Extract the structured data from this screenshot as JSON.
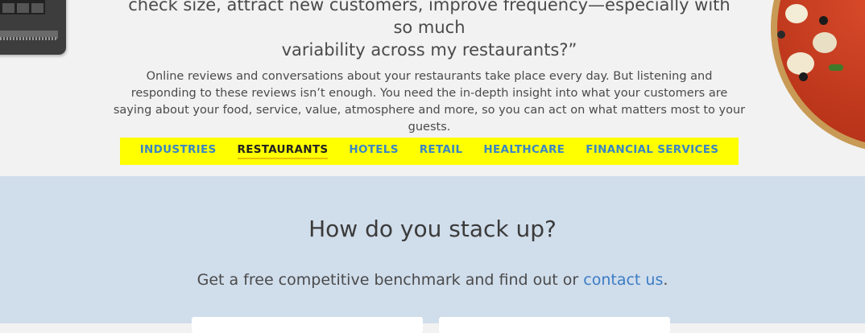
{
  "hero": {
    "quote_line1": "check size, attract new customers, improve frequency—especially with so much",
    "quote_line2": "variability across my restaurants?”",
    "paragraph": "Online reviews and conversations about your restaurants take place every day. But listening and responding to these reviews isn’t enough. You need the in-depth insight into what your customers are saying about your food, service, value, atmosphere and more, so you can act on what matters most to your guests."
  },
  "tabs": [
    {
      "label": "INDUSTRIES",
      "active": false
    },
    {
      "label": "RESTAURANTS",
      "active": true
    },
    {
      "label": "HOTELS",
      "active": false
    },
    {
      "label": "RETAIL",
      "active": false
    },
    {
      "label": "HEALTHCARE",
      "active": false
    },
    {
      "label": "FINANCIAL SERVICES",
      "active": false
    }
  ],
  "benchmark": {
    "title": "How do you stack up?",
    "subtitle_prefix": "Get a free competitive benchmark and find out or ",
    "link_text": "contact us",
    "subtitle_suffix": "."
  },
  "colors": {
    "tab_bar_bg": "#ffff00",
    "tab_link": "#3a86c4",
    "tab_active": "#222222",
    "section_bg": "#d0ddeb",
    "link": "#3a7cc4"
  },
  "icons": {
    "device": "terminal-device-image",
    "pizza": "pizza-image"
  }
}
